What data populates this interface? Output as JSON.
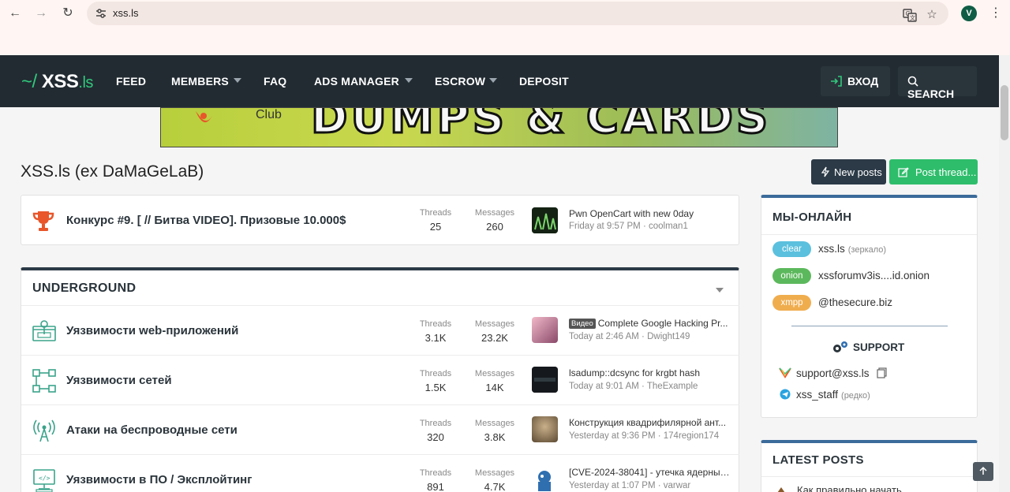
{
  "browser": {
    "url": "xss.ls",
    "profile_initial": "V"
  },
  "nav": {
    "logo_tilde": "~/",
    "logo_main": "XSS",
    "logo_tld": ".ls",
    "links": [
      "FEED",
      "MEMBERS",
      "FAQ",
      "ADS MANAGER",
      "ESCROW",
      "DEPOSIT"
    ],
    "login": "ВХОД",
    "search": "SEARCH"
  },
  "banner": {
    "club": "Club",
    "text": "DUMPS & CARDS"
  },
  "page": {
    "title": "XSS.ls (ex DaMaGeLaB)",
    "new_posts": "New posts",
    "post_thread": "Post thread..."
  },
  "contest": {
    "title": "Конкурс #9. [ // Битва VIDEO]. Призовые 10.000$",
    "threads_label": "Threads",
    "threads": "25",
    "messages_label": "Messages",
    "messages": "260",
    "last_title": "Pwn OpenCart with new 0day",
    "last_meta": "Friday at 9:57 PM · coolman1"
  },
  "underground": {
    "header": "UNDERGROUND",
    "nodes": [
      {
        "title": "Уязвимости web-приложений",
        "threads": "3.1K",
        "messages": "23.2K",
        "tag": "Видео",
        "last_title": "Complete Google Hacking Pr...",
        "last_meta": "Today at 2:46 AM · Dwight149"
      },
      {
        "title": "Уязвимости сетей",
        "threads": "1.5K",
        "messages": "14K",
        "tag": "",
        "last_title": "lsadump::dcsync for krgbt hash",
        "last_meta": "Today at 9:01 AM · TheExample"
      },
      {
        "title": "Атаки на беспроводные сети",
        "threads": "320",
        "messages": "3.8K",
        "tag": "",
        "last_title": "Конструкция квадрифилярной ант...",
        "last_meta": "Yesterday at 9:36 PM · 174region174"
      },
      {
        "title": "Уязвимости в ПО / Эксплойтинг",
        "threads": "891",
        "messages": "4.7K",
        "tag": "",
        "last_title": "[CVE-2024-38041] - утечка ядерных...",
        "last_meta": "Yesterday at 1:07 PM · varwar"
      }
    ],
    "threads_label": "Threads",
    "messages_label": "Messages"
  },
  "sidebar": {
    "online_header": "МЫ-ОНЛАЙН",
    "mirrors": [
      {
        "pill": "clear",
        "text": "xss.ls",
        "note": "(зеркало)",
        "color": "#5bc0de"
      },
      {
        "pill": "onion",
        "text": "xssforumv3is....id.onion",
        "note": "",
        "color": "#5cb85c"
      },
      {
        "pill": "xmpp",
        "text": "@thesecure.biz",
        "note": "",
        "color": "#f0ad4e"
      }
    ],
    "support_header": "SUPPORT",
    "support_email": "support@xss.ls",
    "support_tg": "xss_staff",
    "support_tg_note": "(редко)",
    "latest_header": "LATEST POSTS",
    "latest_first": "Как правильно начать"
  },
  "colors": {
    "nav_bg": "#222b32",
    "accent_green": "#2ebd6b",
    "dark_button": "#2c3a47",
    "icon_orange": "#e8562a",
    "icon_teal": "#3aa38a"
  }
}
